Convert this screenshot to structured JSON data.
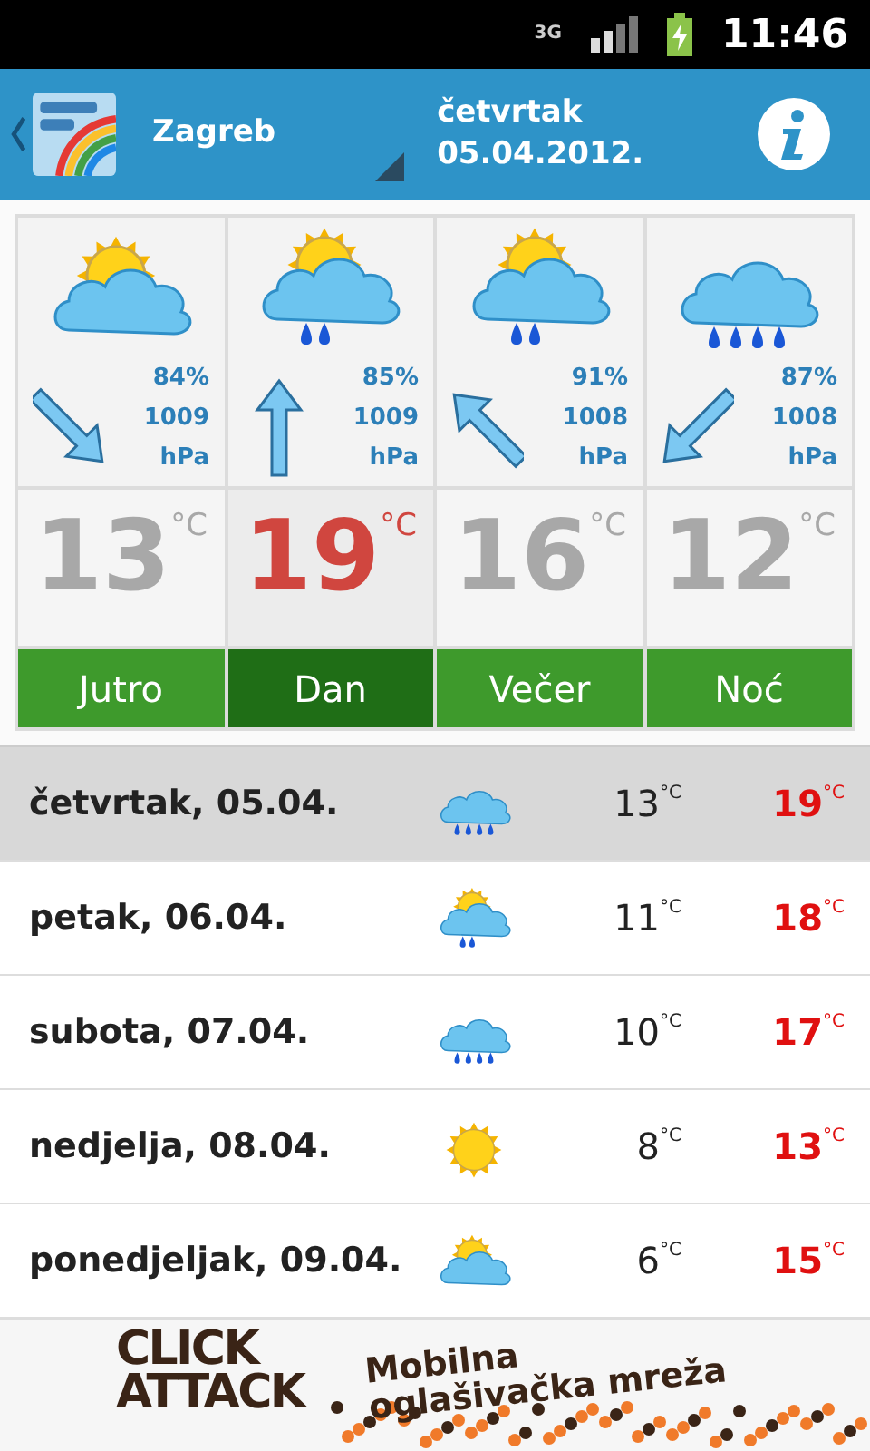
{
  "status_bar": {
    "network": "3G",
    "time": "11:46"
  },
  "header": {
    "city": "Zagreb",
    "day": "četvrtak",
    "date": "05.04.2012."
  },
  "periods": [
    {
      "label": "Jutro",
      "selected": false,
      "weather": {
        "kind": "partly-cloudy"
      },
      "wind": {
        "kind": "down-right"
      },
      "humidity": "84%",
      "pressure": "1009",
      "pressure_unit": "hPa",
      "temp": "13",
      "temp_unit": "°C"
    },
    {
      "label": "Dan",
      "selected": true,
      "weather": {
        "kind": "partly-cloudy-rain"
      },
      "wind": {
        "kind": "up"
      },
      "humidity": "85%",
      "pressure": "1009",
      "pressure_unit": "hPa",
      "temp": "19",
      "temp_unit": "°C"
    },
    {
      "label": "Večer",
      "selected": false,
      "weather": {
        "kind": "partly-cloudy-rain"
      },
      "wind": {
        "kind": "up-left"
      },
      "humidity": "91%",
      "pressure": "1008",
      "pressure_unit": "hPa",
      "temp": "16",
      "temp_unit": "°C"
    },
    {
      "label": "Noć",
      "selected": false,
      "weather": {
        "kind": "rain"
      },
      "wind": {
        "kind": "down-left"
      },
      "humidity": "87%",
      "pressure": "1008",
      "pressure_unit": "hPa",
      "temp": "12",
      "temp_unit": "°C"
    }
  ],
  "days": [
    {
      "name": "četvrtak, 05.04.",
      "selected": true,
      "weather": {
        "kind": "rain"
      },
      "min": "13",
      "min_unit": "°C",
      "max": "19",
      "max_unit": "°C"
    },
    {
      "name": "petak, 06.04.",
      "selected": false,
      "weather": {
        "kind": "partly-cloudy-rain"
      },
      "min": "11",
      "min_unit": "°C",
      "max": "18",
      "max_unit": "°C"
    },
    {
      "name": "subota, 07.04.",
      "selected": false,
      "weather": {
        "kind": "rain"
      },
      "min": "10",
      "min_unit": "°C",
      "max": "17",
      "max_unit": "°C"
    },
    {
      "name": "nedjelja, 08.04.",
      "selected": false,
      "weather": {
        "kind": "sunny"
      },
      "min": "8",
      "min_unit": "°C",
      "max": "13",
      "max_unit": "°C"
    },
    {
      "name": "ponedjeljak, 09.04.",
      "selected": false,
      "weather": {
        "kind": "partly-cloudy"
      },
      "min": "6",
      "min_unit": "°C",
      "max": "15",
      "max_unit": "°C"
    }
  ],
  "ad": {
    "brand_line_1": "CLICK",
    "brand_line_2": "ATTACK",
    "slogan_line_1": "Mobilna",
    "slogan_line_2": "oglašivačka mreža"
  }
}
